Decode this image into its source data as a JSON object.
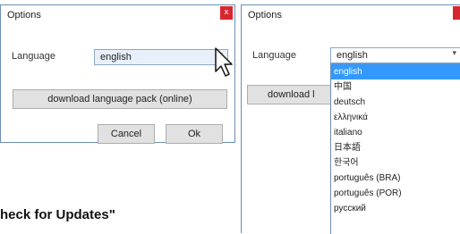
{
  "window_left": {
    "title": "Options",
    "close_glyph": "x",
    "language_label": "Language",
    "language_value": "english",
    "dropdown_arrow": "▾",
    "download_button": "download language pack (online)",
    "cancel_button": "Cancel",
    "ok_button": "Ok"
  },
  "window_right": {
    "title": "Options",
    "close_glyph": "",
    "language_label": "Language",
    "language_value": "english",
    "dropdown_arrow": "▾",
    "download_button": "download l",
    "options": [
      "english",
      "中国",
      "deutsch",
      "ελληνικά",
      "italiano",
      "日本語",
      "한국어",
      "português (BRA)",
      "português (POR)",
      "русский"
    ],
    "selected_index": 0
  },
  "caption": "heck for Updates\"",
  "colors": {
    "accent": "#3399ff",
    "close": "#d9262e",
    "window_border": "#6b8fb5"
  },
  "icons": {
    "cursor": "mouse-pointer-icon",
    "dropdown": "chevron-down-icon",
    "close": "close-icon"
  }
}
